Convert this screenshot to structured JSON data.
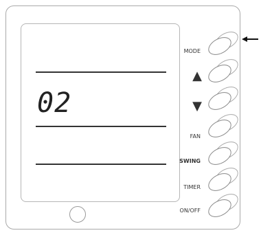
{
  "display": {
    "value": "02"
  },
  "buttons": [
    {
      "label": "MODE"
    },
    {
      "label": "▲"
    },
    {
      "label": "▼"
    },
    {
      "label": "FAN"
    },
    {
      "label": "SWING"
    },
    {
      "label": "TIMER"
    },
    {
      "label": "ON/OFF"
    }
  ],
  "pointer": {
    "icon": "left-arrow-icon"
  }
}
